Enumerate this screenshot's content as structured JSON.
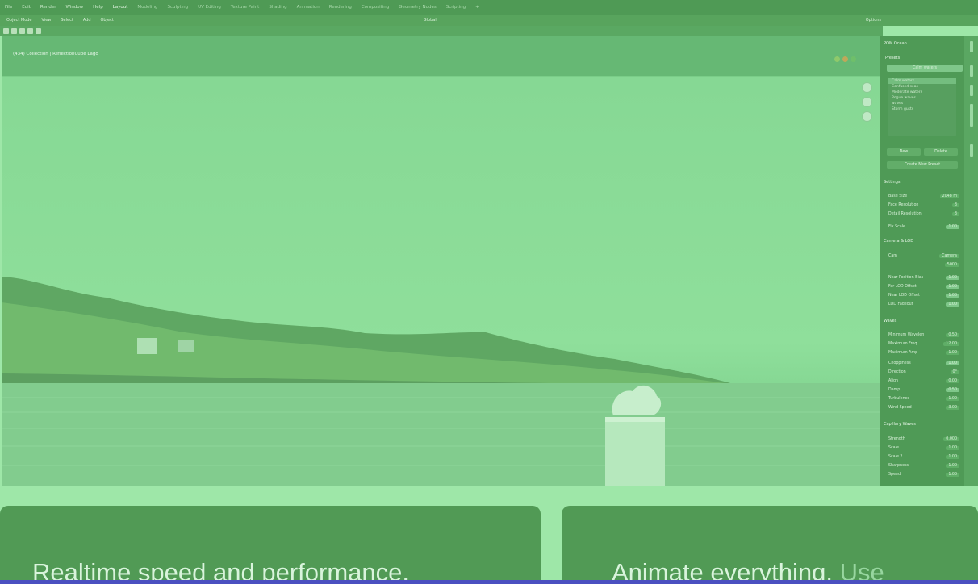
{
  "menubar": {
    "menus": [
      "File",
      "Edit",
      "Render",
      "Window",
      "Help"
    ],
    "workspaces": [
      "Layout",
      "Modeling",
      "Sculpting",
      "UV Editing",
      "Texture Paint",
      "Shading",
      "Animation",
      "Rendering",
      "Compositing",
      "Geometry Nodes",
      "Scripting"
    ],
    "active_workspace": "Layout",
    "add_tab": "+"
  },
  "toolbar": {
    "mode": "Object Mode",
    "menus": [
      "View",
      "Select",
      "Add",
      "Object"
    ],
    "orientation": "Global",
    "options": "Options"
  },
  "viewport": {
    "title": "(434) Collection | ReflectionCube Lago"
  },
  "panel": {
    "header": "POM Ocean",
    "presets_label": "Presets",
    "preset_value": "Calm waters",
    "list_items": [
      "Calm waters",
      "Confused seas",
      "Moderate waters",
      "Rogue waves",
      "waves",
      "Storm gusts"
    ],
    "new_button": "New",
    "delete_button": "Delete",
    "create_preset_button": "Create New Preset",
    "settings": {
      "title": "Settings",
      "rows": [
        {
          "label": "Base Size",
          "value": "2048 m"
        },
        {
          "label": "Face Resolution",
          "value": "3"
        },
        {
          "label": "Detail Resolution",
          "value": "3"
        },
        {
          "label": "Fix Scale",
          "value": "1.00"
        }
      ]
    },
    "camera": {
      "title": "Camera & LOD",
      "cam_label": "Cam",
      "cam_value": "Camera",
      "lod_value": "5000",
      "rows": [
        {
          "label": "Near Position Bias",
          "value": "1.00"
        },
        {
          "label": "Far LOD Offset",
          "value": "1.00"
        },
        {
          "label": "Near LOD Offset",
          "value": "1.00"
        },
        {
          "label": "LOD Fadeout",
          "value": "1.00"
        }
      ]
    },
    "waves": {
      "title": "Waves",
      "rows": [
        {
          "label": "Minimum Wavelen",
          "value": "0.50"
        },
        {
          "label": "Maximum Freq",
          "value": "12.00"
        },
        {
          "label": "Maximum Amp",
          "value": "1.00"
        },
        {
          "label": "Choppiness",
          "value": "1.00"
        },
        {
          "label": "Direction",
          "value": "0°"
        },
        {
          "label": "Align",
          "value": "0.00"
        },
        {
          "label": "Damp",
          "value": "0.50"
        },
        {
          "label": "Turbulence",
          "value": "1.00"
        },
        {
          "label": "Wind Speed",
          "value": "3.00"
        }
      ]
    },
    "capillary": {
      "title": "Capillary Waves",
      "rows": [
        {
          "label": "Strength",
          "value": "0.000"
        },
        {
          "label": "Scale",
          "value": "1.00"
        },
        {
          "label": "Scale 2",
          "value": "1.00"
        },
        {
          "label": "Sharpness",
          "value": "1.00"
        },
        {
          "label": "Speed",
          "value": "1.00"
        }
      ]
    }
  },
  "cards": [
    {
      "text": "Realtime speed and performance.",
      "muted": ""
    },
    {
      "text": "Animate everything.",
      "muted": " Use"
    }
  ],
  "colors": {
    "overlay_green": "#9ee7a8",
    "card_bg": "#519a55",
    "accent_bar": "#4b50c0"
  }
}
